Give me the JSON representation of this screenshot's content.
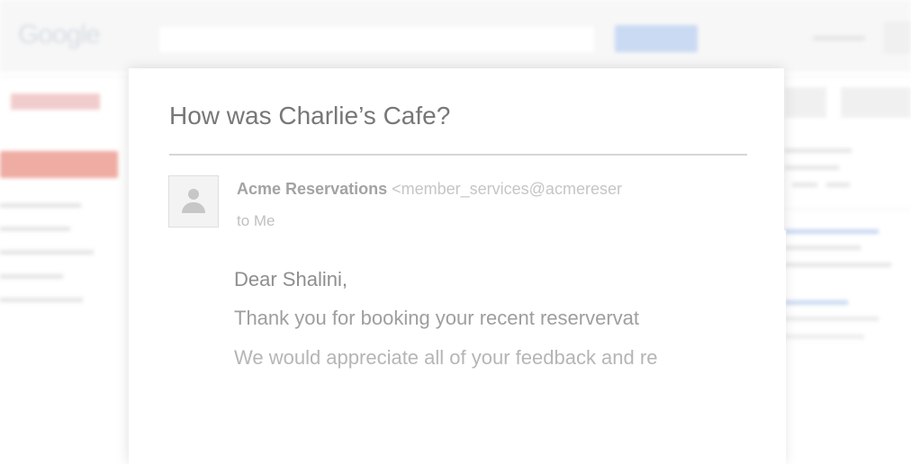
{
  "background": {
    "logo": "Google"
  },
  "email": {
    "subject": "How was Charlie’s Cafe?",
    "sender_name": "Acme Reservations",
    "sender_email": "<member_services@acmereser",
    "recipient": "to Me",
    "body": [
      "Dear Shalini,",
      "Thank you for booking your recent reservervat",
      "We would appreciate all of your feedback and re"
    ]
  },
  "icons": {
    "avatar": "person-silhouette-icon"
  },
  "colors": {
    "subject_text": "#777777",
    "compose_red": "#d94c3a",
    "search_blue": "#9fbde9"
  }
}
